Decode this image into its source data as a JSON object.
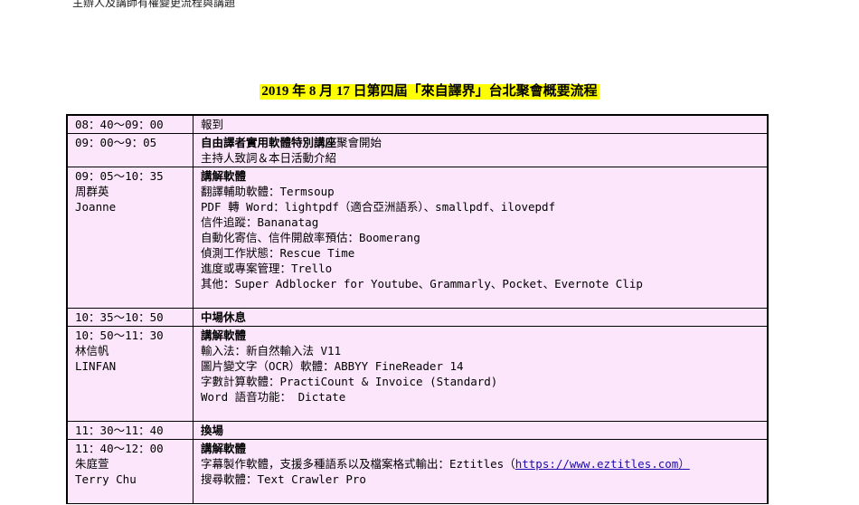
{
  "header_note": "主辦人及講師有權變更流程與講題",
  "title": "2019 年 8 月 17 日第四屆「來自譯界」台北聚會概要流程",
  "rows": [
    {
      "time": "08：40～09：00",
      "heading": "報到"
    },
    {
      "time": "09：00～9：05",
      "heading": "自由譯者實用軟體特別講座",
      "heading_suffix": "聚會開始",
      "lines": [
        "主持人致詞＆本日活動介紹"
      ]
    },
    {
      "time": "09：05～10：35",
      "speaker": "周群英",
      "speaker_en": "Joanne",
      "heading": "講解軟體",
      "lines": [
        "翻譯輔助軟體：Termsoup",
        "PDF 轉 Word：lightpdf（適合亞洲語系）、smallpdf、ilovepdf",
        "信件追蹤：Bananatag",
        "自動化寄信、信件開啟率預估：Boomerang",
        "偵測工作狀態：Rescue Time",
        "進度或專案管理：Trello",
        "其他：Super Adblocker for Youtube、Grammarly、Pocket、Evernote Clip"
      ]
    },
    {
      "time": "10：35～10：50",
      "heading": "中場休息"
    },
    {
      "time": "10：50～11：30",
      "speaker": "林信帆",
      "speaker_en": "LINFAN",
      "heading": "講解軟體",
      "lines": [
        "輸入法：新自然輸入法 V11",
        "圖片變文字（OCR）軟體：ABBYY FineReader 14",
        "字數計算軟體：PractiCount & Invoice (Standard)",
        "Word 語音功能： Dictate"
      ]
    },
    {
      "time": "11：30～11：40",
      "heading": "換場"
    },
    {
      "time": "11：40～12：00",
      "speaker": "朱庭萱",
      "speaker_en": "Terry Chu",
      "heading": "講解軟體",
      "line1_prefix": "字幕製作軟體，支援多種語系以及檔案格式輸出：Eztitles（",
      "line1_link": "https://www.eztitles.com）",
      "line2": "搜尋軟體：Text Crawler Pro"
    }
  ]
}
